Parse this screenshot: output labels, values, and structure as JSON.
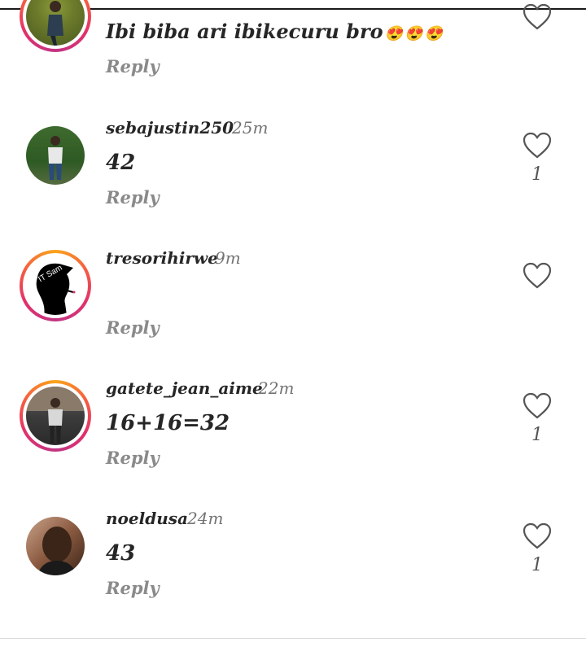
{
  "comments": [
    {
      "username": "",
      "time": "",
      "text": "Ibi biba ari ibikecuru bro",
      "emojis": [
        "😍",
        "😍",
        "😍"
      ],
      "reply": "Reply",
      "likes": ""
    },
    {
      "username": "sebajustin250",
      "time": "25m",
      "text": "42",
      "reply": "Reply",
      "likes": "1"
    },
    {
      "username": "tresorihirwe",
      "time": "9m",
      "text": "",
      "reply": "Reply",
      "likes": "",
      "avatar_text": "IT Sam"
    },
    {
      "username": "gatete_jean_aime",
      "time": "22m",
      "text": "16+16=32",
      "reply": "Reply",
      "likes": "1"
    },
    {
      "username": "noeldusa",
      "time": "24m",
      "text": "43",
      "reply": "Reply",
      "likes": "1"
    }
  ],
  "colors": {
    "story_ring": "#e1306c",
    "heart_stroke": "#555555",
    "reply": "#8a8a8a"
  }
}
